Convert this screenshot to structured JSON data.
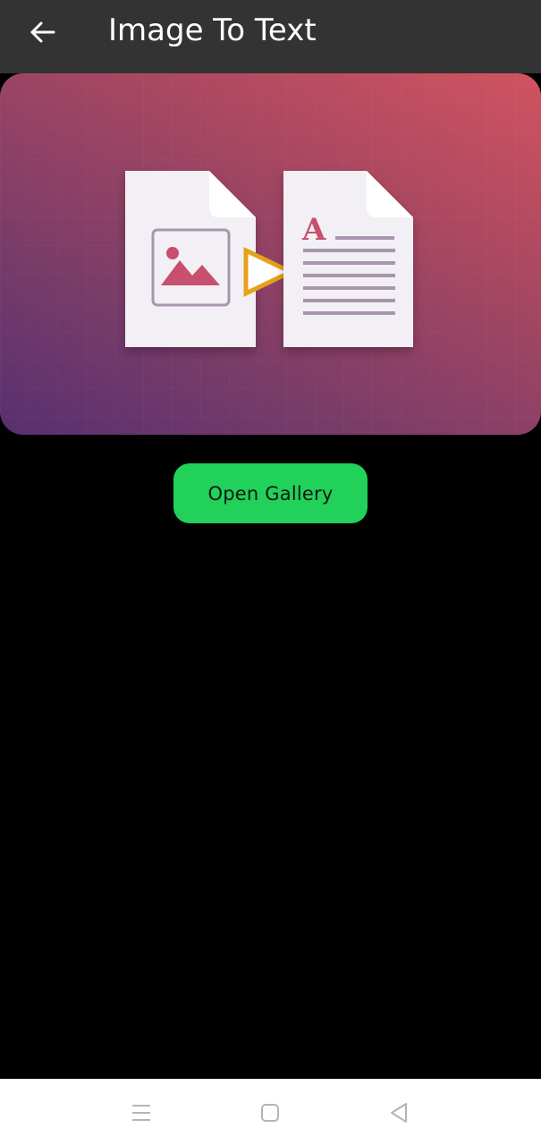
{
  "app_bar": {
    "title": "Image To Text",
    "back_icon": "arrow-left-icon",
    "background": "#333333"
  },
  "banner": {
    "illustration": "image-to-text-illustration",
    "icons": [
      "image-document-icon",
      "play-arrow-icon",
      "text-document-icon"
    ],
    "gradient": [
      "#57306f",
      "#a34662",
      "#d1535f"
    ]
  },
  "actions": {
    "open_gallery_label": "Open Gallery",
    "accent": "#22d15a"
  },
  "nav_bar": {
    "icons": [
      "menu-icon",
      "home-square-icon",
      "back-triangle-icon"
    ]
  }
}
